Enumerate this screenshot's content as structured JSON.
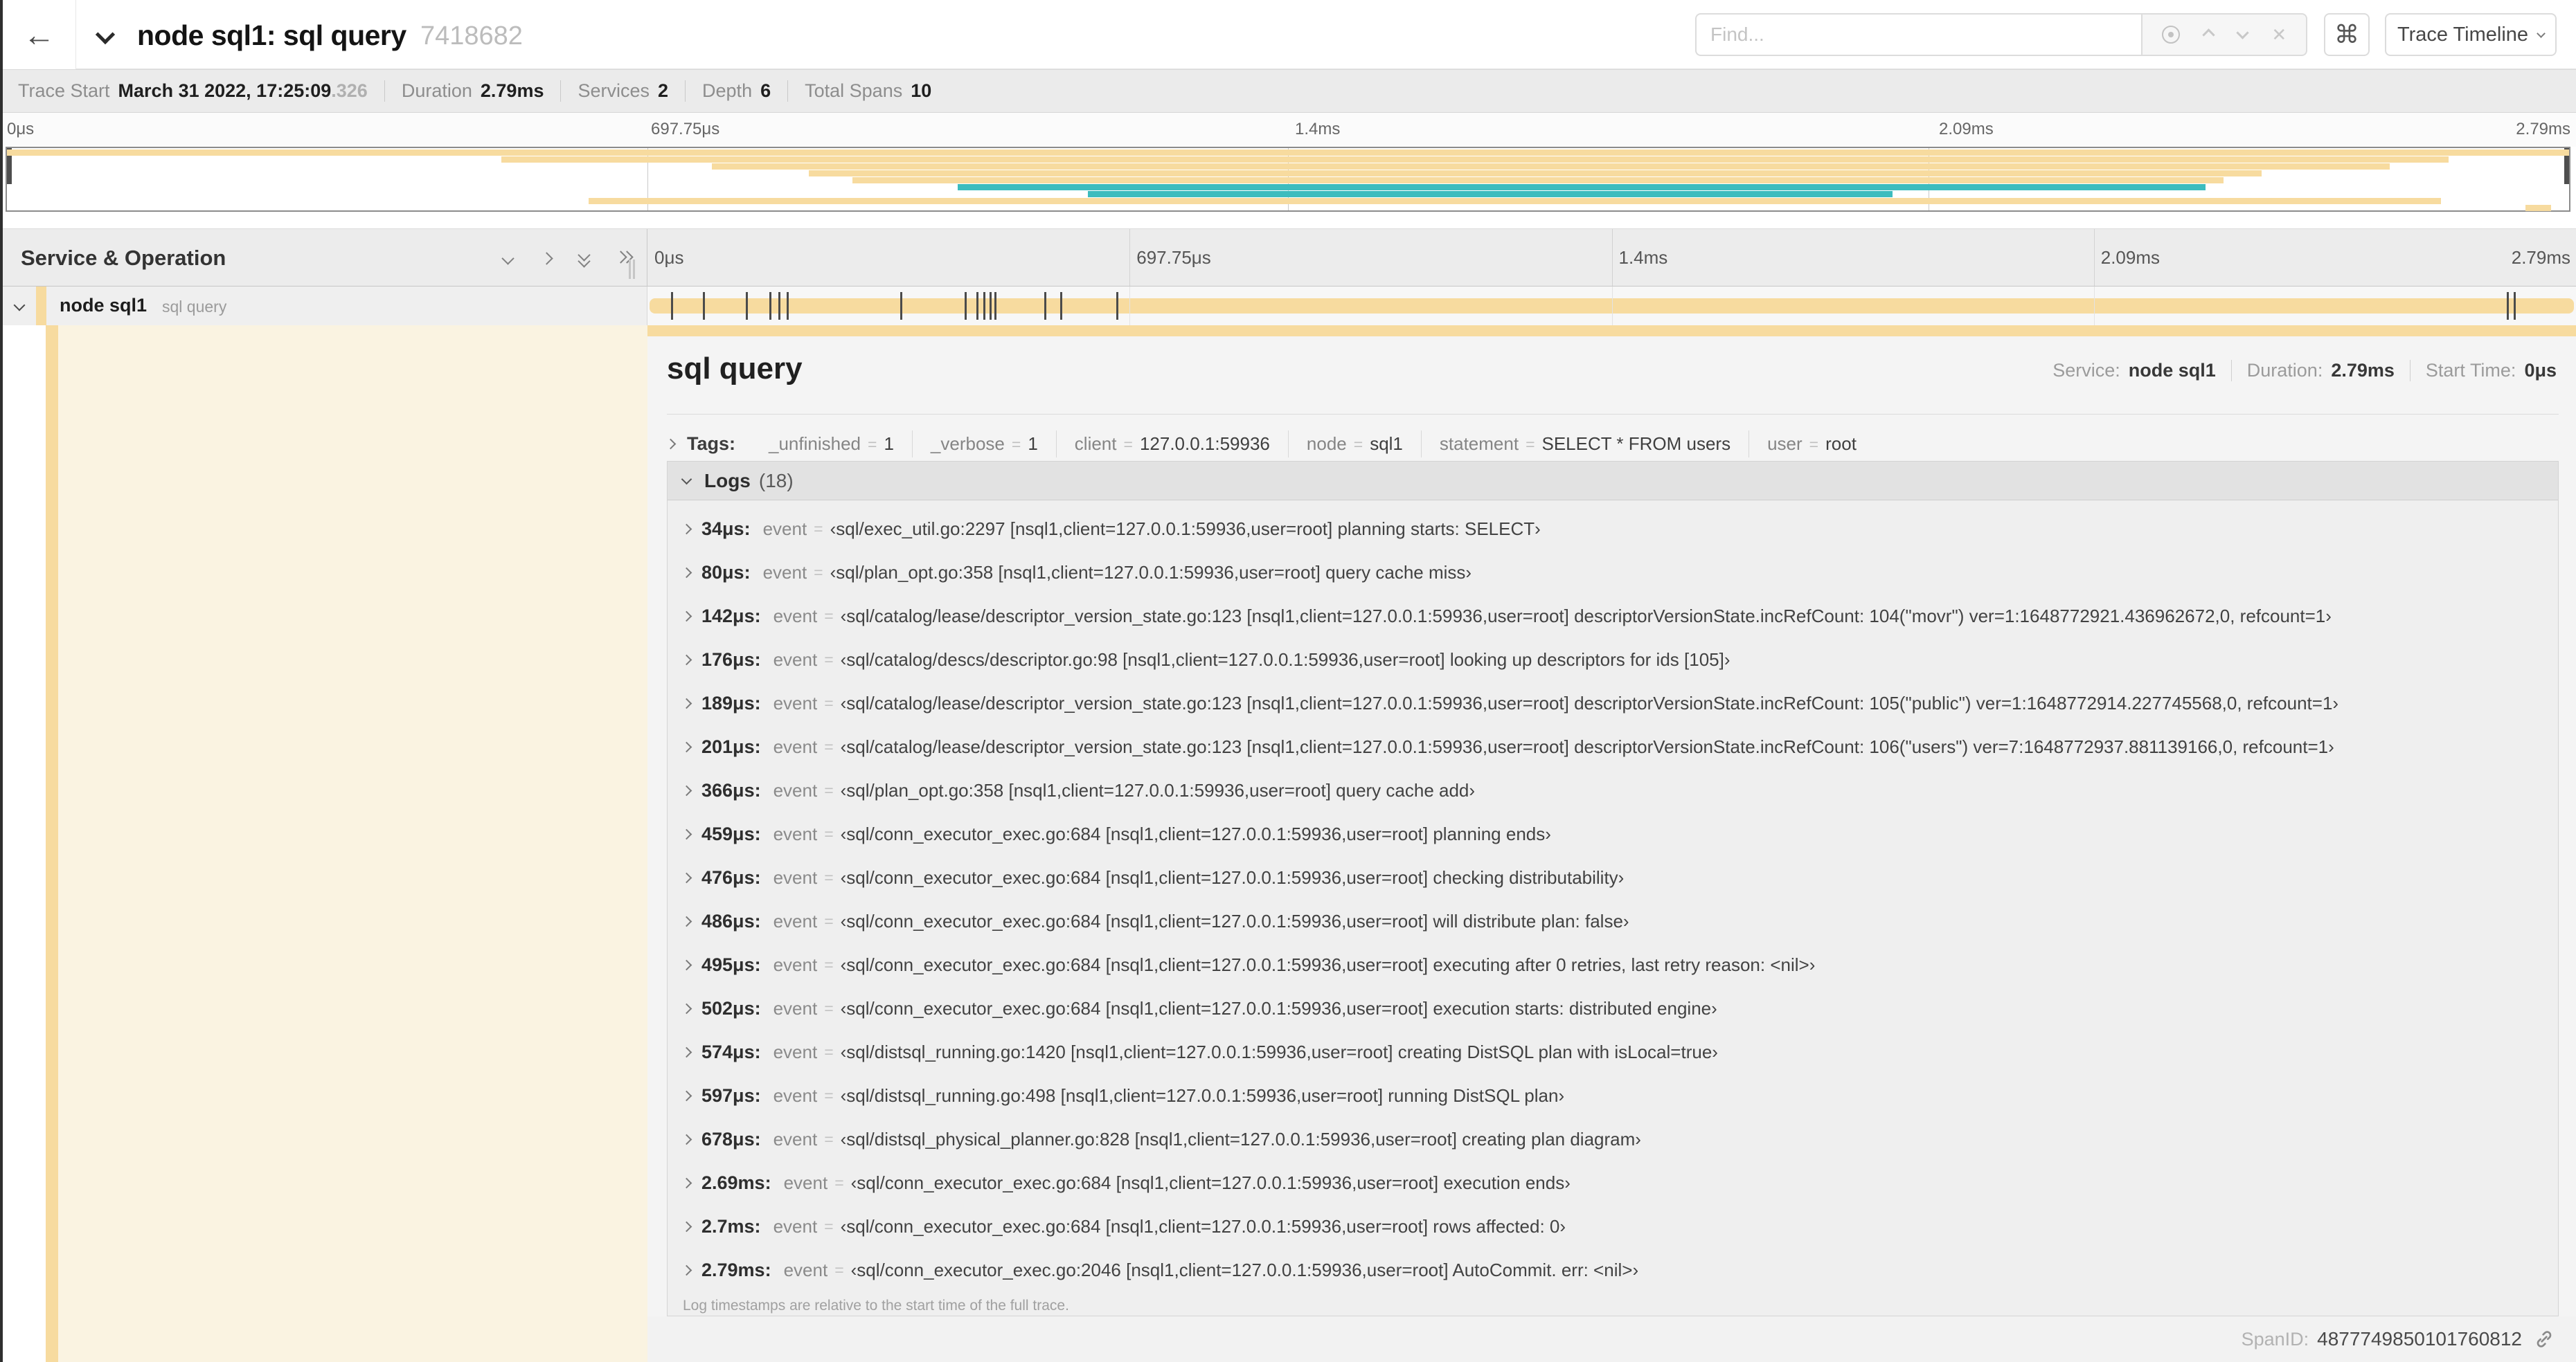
{
  "header": {
    "back_icon": "←",
    "title": "node sql1: sql query",
    "trace_id": "7418682",
    "find_placeholder": "Find...",
    "shortcut_icon": "⌘",
    "view_selector_label": "Trace Timeline"
  },
  "trace_meta": {
    "items": [
      {
        "label": "Trace Start",
        "value": "March 31 2022, 17:25:09",
        "suffix": ".326"
      },
      {
        "label": "Duration",
        "value": "2.79ms"
      },
      {
        "label": "Services",
        "value": "2"
      },
      {
        "label": "Depth",
        "value": "6"
      },
      {
        "label": "Total Spans",
        "value": "10"
      }
    ]
  },
  "ruler": {
    "ticks": [
      "0μs",
      "697.75μs",
      "1.4ms",
      "2.09ms",
      "2.79ms"
    ]
  },
  "colors": {
    "span_tan": "#f7db9f",
    "span_teal": "#3cbcbe",
    "selected_row_bg": "#faf3e1"
  },
  "minimap": {
    "rows": [
      {
        "start": 0,
        "end": 100,
        "color": "tan"
      },
      {
        "start": 19.3,
        "end": 95.3,
        "color": "tan"
      },
      {
        "start": 27.5,
        "end": 93.0,
        "color": "tan"
      },
      {
        "start": 31.3,
        "end": 88.0,
        "color": "tan"
      },
      {
        "start": 33.0,
        "end": 86.5,
        "color": "tan"
      },
      {
        "start": 37.1,
        "end": 85.8,
        "color": "teal"
      },
      {
        "start": 42.2,
        "end": 73.6,
        "color": "teal"
      },
      {
        "start": 22.7,
        "end": 95.0,
        "color": "tan"
      },
      {
        "start": 98.3,
        "end": 99.3,
        "color": "tan"
      }
    ]
  },
  "timeline_header": {
    "label": "Service & Operation"
  },
  "span_row": {
    "service": "node sql1",
    "operation": "sql query",
    "tick_pcts": [
      1.22,
      2.87,
      5.09,
      6.31,
      6.77,
      7.2,
      13.12,
      16.45,
      17.06,
      17.42,
      17.74,
      18.0,
      20.57,
      21.4,
      24.3,
      96.42,
      96.77
    ]
  },
  "detail": {
    "title": "sql query",
    "meta": [
      {
        "label": "Service:",
        "value": "node sql1"
      },
      {
        "label": "Duration:",
        "value": "2.79ms"
      },
      {
        "label": "Start Time:",
        "value": "0μs"
      }
    ],
    "tags_label": "Tags:",
    "tags": [
      {
        "key": "_unfinished",
        "value": "1"
      },
      {
        "key": "_verbose",
        "value": "1"
      },
      {
        "key": "client",
        "value": "127.0.0.1:59936"
      },
      {
        "key": "node",
        "value": "sql1"
      },
      {
        "key": "statement",
        "value": "SELECT * FROM users"
      },
      {
        "key": "user",
        "value": "root"
      }
    ],
    "logs_label": "Logs",
    "logs_count": "(18)",
    "logs": [
      {
        "time": "34μs:",
        "key": "event",
        "value": "‹sql/exec_util.go:2297 [nsql1,client=127.0.0.1:59936,user=root] planning starts: SELECT›"
      },
      {
        "time": "80μs:",
        "key": "event",
        "value": "‹sql/plan_opt.go:358 [nsql1,client=127.0.0.1:59936,user=root] query cache miss›"
      },
      {
        "time": "142μs:",
        "key": "event",
        "value": "‹sql/catalog/lease/descriptor_version_state.go:123 [nsql1,client=127.0.0.1:59936,user=root] descriptorVersionState.incRefCount: 104(\"movr\") ver=1:1648772921.436962672,0, refcount=1›"
      },
      {
        "time": "176μs:",
        "key": "event",
        "value": "‹sql/catalog/descs/descriptor.go:98 [nsql1,client=127.0.0.1:59936,user=root] looking up descriptors for ids [105]›"
      },
      {
        "time": "189μs:",
        "key": "event",
        "value": "‹sql/catalog/lease/descriptor_version_state.go:123 [nsql1,client=127.0.0.1:59936,user=root] descriptorVersionState.incRefCount: 105(\"public\") ver=1:1648772914.227745568,0, refcount=1›"
      },
      {
        "time": "201μs:",
        "key": "event",
        "value": "‹sql/catalog/lease/descriptor_version_state.go:123 [nsql1,client=127.0.0.1:59936,user=root] descriptorVersionState.incRefCount: 106(\"users\") ver=7:1648772937.881139166,0, refcount=1›"
      },
      {
        "time": "366μs:",
        "key": "event",
        "value": "‹sql/plan_opt.go:358 [nsql1,client=127.0.0.1:59936,user=root] query cache add›"
      },
      {
        "time": "459μs:",
        "key": "event",
        "value": "‹sql/conn_executor_exec.go:684 [nsql1,client=127.0.0.1:59936,user=root] planning ends›"
      },
      {
        "time": "476μs:",
        "key": "event",
        "value": "‹sql/conn_executor_exec.go:684 [nsql1,client=127.0.0.1:59936,user=root] checking distributability›"
      },
      {
        "time": "486μs:",
        "key": "event",
        "value": "‹sql/conn_executor_exec.go:684 [nsql1,client=127.0.0.1:59936,user=root] will distribute plan: false›"
      },
      {
        "time": "495μs:",
        "key": "event",
        "value": "‹sql/conn_executor_exec.go:684 [nsql1,client=127.0.0.1:59936,user=root] executing after 0 retries, last retry reason: <nil>›"
      },
      {
        "time": "502μs:",
        "key": "event",
        "value": "‹sql/conn_executor_exec.go:684 [nsql1,client=127.0.0.1:59936,user=root] execution starts: distributed engine›"
      },
      {
        "time": "574μs:",
        "key": "event",
        "value": "‹sql/distsql_running.go:1420 [nsql1,client=127.0.0.1:59936,user=root] creating DistSQL plan with isLocal=true›"
      },
      {
        "time": "597μs:",
        "key": "event",
        "value": "‹sql/distsql_running.go:498 [nsql1,client=127.0.0.1:59936,user=root] running DistSQL plan›"
      },
      {
        "time": "678μs:",
        "key": "event",
        "value": "‹sql/distsql_physical_planner.go:828 [nsql1,client=127.0.0.1:59936,user=root] creating plan diagram›"
      },
      {
        "time": "2.69ms:",
        "key": "event",
        "value": "‹sql/conn_executor_exec.go:684 [nsql1,client=127.0.0.1:59936,user=root] execution ends›"
      },
      {
        "time": "2.7ms:",
        "key": "event",
        "value": "‹sql/conn_executor_exec.go:684 [nsql1,client=127.0.0.1:59936,user=root] rows affected: 0›"
      },
      {
        "time": "2.79ms:",
        "key": "event",
        "value": "‹sql/conn_executor_exec.go:2046 [nsql1,client=127.0.0.1:59936,user=root] AutoCommit. err: <nil>›"
      }
    ],
    "logs_footnote": "Log timestamps are relative to the start time of the full trace.",
    "span_id_label": "SpanID:",
    "span_id": "4877749850101760812"
  }
}
